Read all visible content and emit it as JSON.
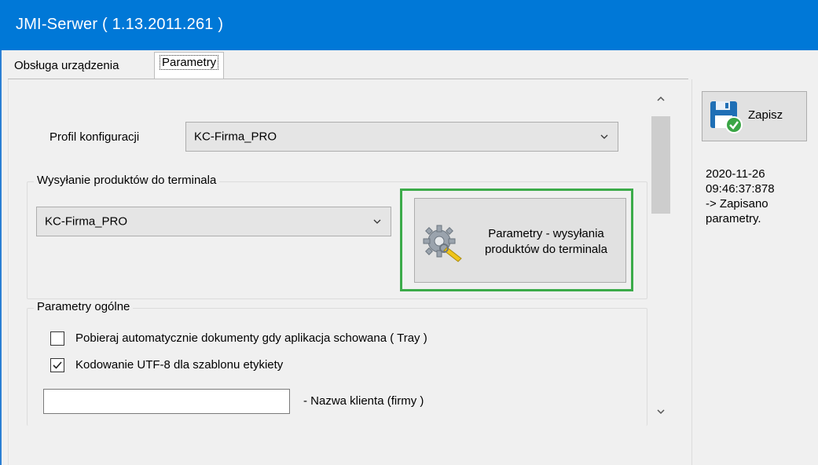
{
  "window": {
    "title": "JMI-Serwer ( 1.13.2011.261 )"
  },
  "tabs": [
    {
      "label": "Obsługa urządzenia"
    },
    {
      "label": "Parametry"
    }
  ],
  "profile": {
    "label": "Profil konfiguracji",
    "value": "KC-Firma_PRO"
  },
  "sending": {
    "group_title": "Wysyłanie produktów do terminala",
    "combo_value": "KC-Firma_PRO",
    "button_line1": "Parametry - wysyłania",
    "button_line2": "produktów do terminala",
    "button_icon": "gears-icon"
  },
  "general": {
    "group_title": "Parametry ogólne",
    "checkbox1_label": "Pobieraj automatycznie dokumenty gdy aplikacja schowana ( Tray )",
    "checkbox1_checked": false,
    "checkbox2_label": "Kodowanie UTF-8 dla szablonu etykiety",
    "checkbox2_checked": true,
    "client_name_value": "",
    "client_name_label": "- Nazwa klienta (firmy )"
  },
  "save": {
    "label": "Zapisz",
    "icon": "floppy-check-icon"
  },
  "log": {
    "line1": "2020-11-26",
    "line2": "09:46:37:878",
    "line3": "-> Zapisano",
    "line4": "parametry."
  },
  "colors": {
    "titlebar": "#0078d7",
    "highlight": "#3cab4a",
    "background": "#f0f0f0"
  }
}
